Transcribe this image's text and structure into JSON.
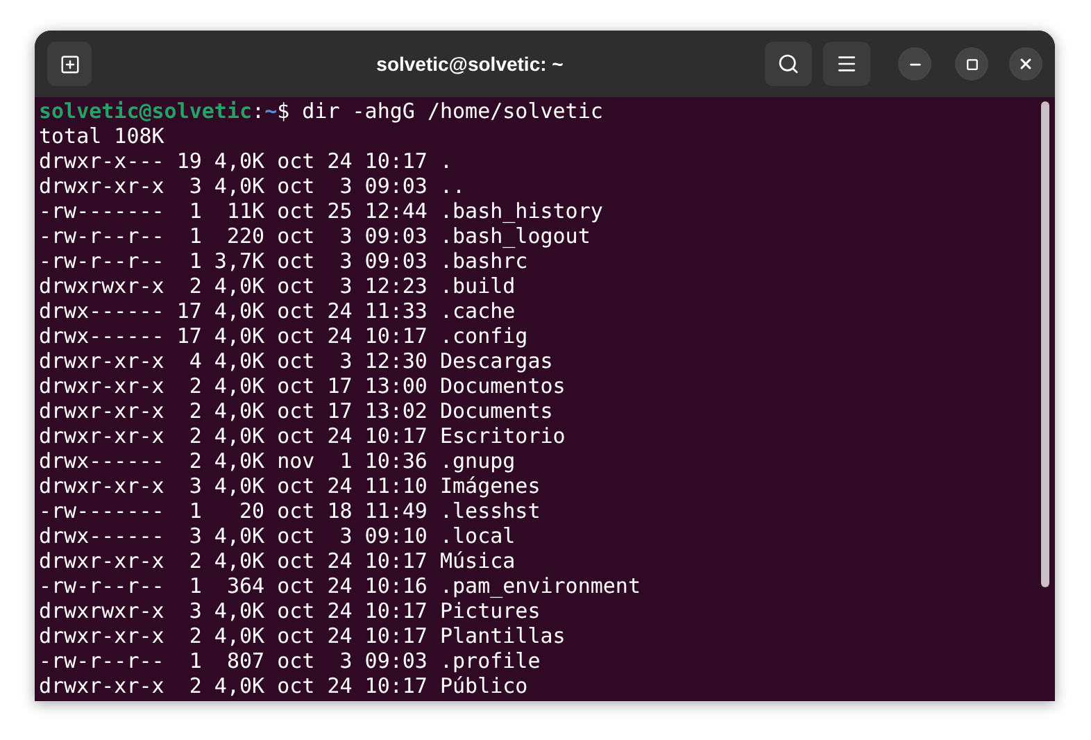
{
  "window": {
    "title": "solvetic@solvetic: ~"
  },
  "prompt": {
    "user_host": "solvetic@solvetic",
    "separator": ":",
    "path": "~",
    "command": "$ dir -ahgG /home/solvetic"
  },
  "output": [
    "total 108K",
    "drwxr-x--- 19 4,0K oct 24 10:17 .",
    "drwxr-xr-x  3 4,0K oct  3 09:03 ..",
    "-rw-------  1  11K oct 25 12:44 .bash_history",
    "-rw-r--r--  1  220 oct  3 09:03 .bash_logout",
    "-rw-r--r--  1 3,7K oct  3 09:03 .bashrc",
    "drwxrwxr-x  2 4,0K oct  3 12:23 .build",
    "drwx------ 17 4,0K oct 24 11:33 .cache",
    "drwx------ 17 4,0K oct 24 10:17 .config",
    "drwxr-xr-x  4 4,0K oct  3 12:30 Descargas",
    "drwxr-xr-x  2 4,0K oct 17 13:00 Documentos",
    "drwxr-xr-x  2 4,0K oct 17 13:02 Documents",
    "drwxr-xr-x  2 4,0K oct 24 10:17 Escritorio",
    "drwx------  2 4,0K nov  1 10:36 .gnupg",
    "drwxr-xr-x  3 4,0K oct 24 11:10 Imágenes",
    "-rw-------  1   20 oct 18 11:49 .lesshst",
    "drwx------  3 4,0K oct  3 09:10 .local",
    "drwxr-xr-x  2 4,0K oct 24 10:17 Música",
    "-rw-r--r--  1  364 oct 24 10:16 .pam_environment",
    "drwxrwxr-x  3 4,0K oct 24 10:17 Pictures",
    "drwxr-xr-x  2 4,0K oct 24 10:17 Plantillas",
    "-rw-r--r--  1  807 oct  3 09:03 .profile",
    "drwxr-xr-x  2 4,0K oct 24 10:17 Público"
  ]
}
